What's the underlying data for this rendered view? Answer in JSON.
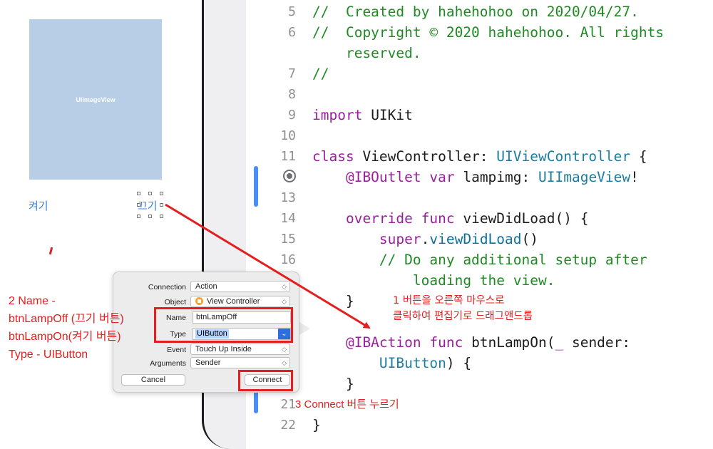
{
  "storyboard": {
    "image_view_label": "UIImageView",
    "button_on": "켜기",
    "button_off": "끄기"
  },
  "editor": {
    "lines": [
      {
        "num": "5",
        "segments": [
          {
            "t": "//  Created by hahehohoo on 2020/04/27.",
            "c": "cm"
          }
        ]
      },
      {
        "num": "6",
        "segments": [
          {
            "t": "//  Copyright © 2020 hahehohoo. All rights",
            "c": "cm"
          }
        ]
      },
      {
        "num": "",
        "segments": [
          {
            "t": "    reserved.",
            "c": "cm"
          }
        ]
      },
      {
        "num": "7",
        "segments": [
          {
            "t": "//",
            "c": "cm"
          }
        ]
      },
      {
        "num": "8",
        "segments": []
      },
      {
        "num": "9",
        "segments": [
          {
            "t": "import",
            "c": "kw"
          },
          {
            "t": " UIKit",
            "c": ""
          }
        ]
      },
      {
        "num": "10",
        "segments": []
      },
      {
        "num": "11",
        "segments": [
          {
            "t": "class",
            "c": "kw"
          },
          {
            "t": " ViewController: ",
            "c": ""
          },
          {
            "t": "UIViewController",
            "c": "ty"
          },
          {
            "t": " {",
            "c": ""
          }
        ]
      },
      {
        "num": "",
        "segments": [
          {
            "t": "    @IBOutlet var",
            "c": "kw"
          },
          {
            "t": " lampimg: ",
            "c": ""
          },
          {
            "t": "UIImageView",
            "c": "ty"
          },
          {
            "t": "!",
            "c": ""
          }
        ]
      },
      {
        "num": "13",
        "segments": []
      },
      {
        "num": "14",
        "segments": [
          {
            "t": "    override func",
            "c": "kw"
          },
          {
            "t": " viewDidLoad() {",
            "c": ""
          }
        ]
      },
      {
        "num": "15",
        "segments": [
          {
            "t": "        super",
            "c": "kw"
          },
          {
            "t": ".",
            "c": ""
          },
          {
            "t": "viewDidLoad",
            "c": "fn"
          },
          {
            "t": "()",
            "c": ""
          }
        ]
      },
      {
        "num": "16",
        "segments": [
          {
            "t": "        // Do any additional setup after",
            "c": "cm"
          }
        ]
      },
      {
        "num": "",
        "segments": [
          {
            "t": "            loading the view.",
            "c": "cm"
          }
        ]
      },
      {
        "num": "",
        "segments": [
          {
            "t": "    }",
            "c": ""
          }
        ]
      },
      {
        "num": "",
        "segments": []
      },
      {
        "num": "",
        "segments": [
          {
            "t": "    @IBAction func",
            "c": "kw"
          },
          {
            "t": " btnLampOn(",
            "c": ""
          },
          {
            "t": "_",
            "c": "kw"
          },
          {
            "t": " sender:",
            "c": ""
          }
        ]
      },
      {
        "num": "",
        "segments": [
          {
            "t": "        UIButton",
            "c": "ty"
          },
          {
            "t": ") {",
            "c": ""
          }
        ]
      },
      {
        "num": "",
        "segments": [
          {
            "t": "    }",
            "c": ""
          }
        ]
      },
      {
        "num": "21",
        "segments": []
      },
      {
        "num": "22",
        "segments": [
          {
            "t": "}",
            "c": ""
          }
        ]
      }
    ]
  },
  "popup": {
    "connection_label": "Connection",
    "connection_value": "Action",
    "object_label": "Object",
    "object_value": "View Controller",
    "name_label": "Name",
    "name_value": "btnLampOff",
    "type_label": "Type",
    "type_value": "UIButton",
    "event_label": "Event",
    "event_value": "Touch Up Inside",
    "arguments_label": "Arguments",
    "arguments_value": "Sender",
    "cancel_label": "Cancel",
    "connect_label": "Connect"
  },
  "annotations": {
    "left_lines": [
      "2 Name -",
      "btnLampOff (끄기 버튼)",
      "btnLampOn(켜기 버튼)",
      "Type - UIButton"
    ],
    "note1_line1": "1 버튼을 오른쪽 마우스로",
    "note1_line2": "클릭하여 편집기로 드래그앤드롭",
    "note3": "3 Connect 버튼 누르기"
  },
  "colors": {
    "annotation": "#e41e1e",
    "comment": "#1f8a23",
    "keyword": "#9b1f9c",
    "type": "#1c7da0",
    "accent": "#2d6fe0"
  }
}
